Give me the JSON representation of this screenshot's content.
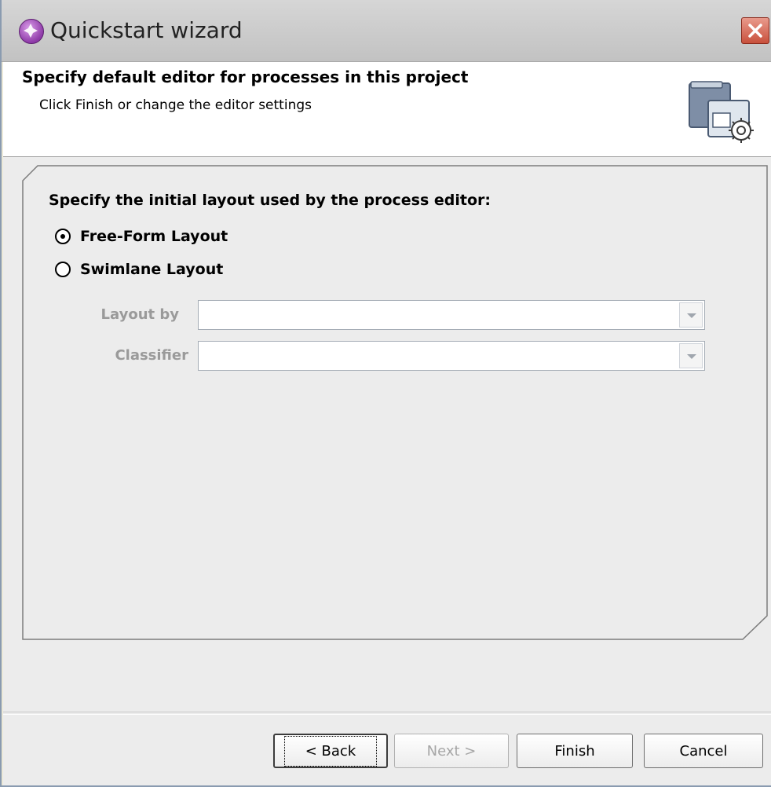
{
  "window": {
    "title": "Quickstart wizard",
    "icon": "wizard-icon"
  },
  "header": {
    "title": "Specify default editor for processes in this project",
    "subtitle": "Click Finish or change the editor settings",
    "icon": "editor-settings-icon"
  },
  "content": {
    "section_label": "Specify the initial layout used by the process editor:",
    "radios": [
      {
        "label": "Free-Form Layout",
        "checked": true
      },
      {
        "label": "Swimlane Layout",
        "checked": false
      }
    ],
    "fields": [
      {
        "label": "Layout by",
        "value": "",
        "enabled": false
      },
      {
        "label": "Classifier",
        "value": "",
        "enabled": false
      }
    ]
  },
  "buttons": {
    "back": "< Back",
    "next": "Next >",
    "finish": "Finish",
    "cancel": "Cancel"
  }
}
